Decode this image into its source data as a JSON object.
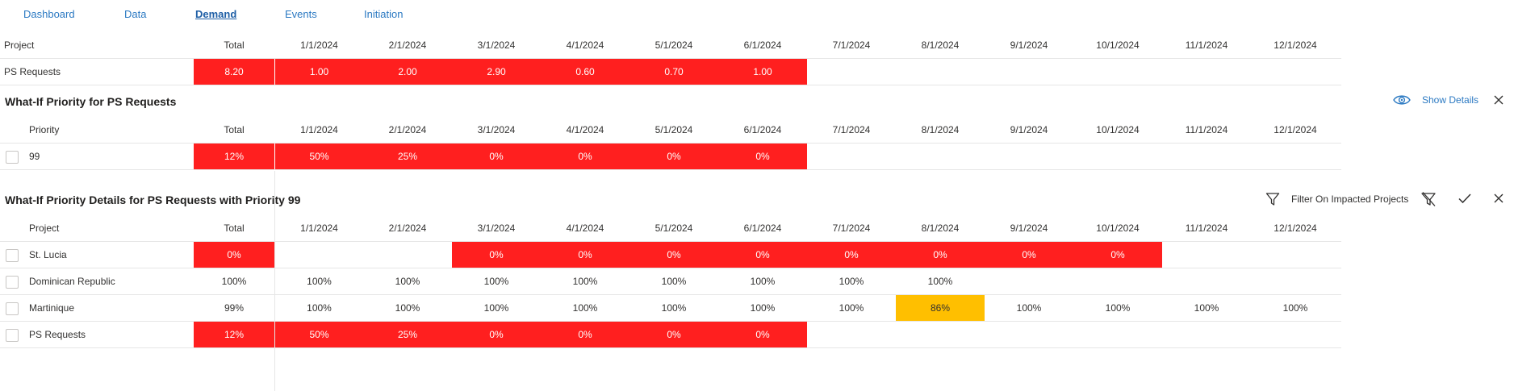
{
  "nav": {
    "tabs": [
      {
        "label": "Dashboard"
      },
      {
        "label": "Data"
      },
      {
        "label": "Demand"
      },
      {
        "label": "Events"
      },
      {
        "label": "Initiation"
      }
    ],
    "active_index": 2
  },
  "summary": {
    "columns": [
      "Project",
      "Total",
      "1/1/2024",
      "2/1/2024",
      "3/1/2024",
      "4/1/2024",
      "5/1/2024",
      "6/1/2024",
      "7/1/2024",
      "8/1/2024",
      "9/1/2024",
      "10/1/2024",
      "11/1/2024",
      "12/1/2024"
    ],
    "rows": [
      {
        "cells": [
          "PS Requests",
          "8.20",
          "1.00",
          "2.00",
          "2.90",
          "0.60",
          "0.70",
          "1.00",
          "",
          "",
          "",
          "",
          "",
          ""
        ],
        "status": [
          "none",
          "red",
          "red",
          "red",
          "red",
          "red",
          "red",
          "red",
          "none",
          "none",
          "none",
          "none",
          "none",
          "none"
        ]
      }
    ]
  },
  "priority": {
    "title": "What-If Priority for PS Requests",
    "show_details_label": "Show Details",
    "columns": [
      "Priority",
      "Total",
      "1/1/2024",
      "2/1/2024",
      "3/1/2024",
      "4/1/2024",
      "5/1/2024",
      "6/1/2024",
      "7/1/2024",
      "8/1/2024",
      "9/1/2024",
      "10/1/2024",
      "11/1/2024",
      "12/1/2024"
    ],
    "rows": [
      {
        "cells": [
          "99",
          "12%",
          "50%",
          "25%",
          "0%",
          "0%",
          "0%",
          "0%",
          "",
          "",
          "",
          "",
          "",
          ""
        ],
        "status": [
          "none",
          "red",
          "red",
          "red",
          "red",
          "red",
          "red",
          "red",
          "none",
          "none",
          "none",
          "none",
          "none",
          "none"
        ]
      }
    ]
  },
  "details": {
    "title": "What-If Priority Details for PS Requests with Priority 99",
    "filter_label": "Filter On Impacted Projects",
    "columns": [
      "Project",
      "Total",
      "1/1/2024",
      "2/1/2024",
      "3/1/2024",
      "4/1/2024",
      "5/1/2024",
      "6/1/2024",
      "7/1/2024",
      "8/1/2024",
      "9/1/2024",
      "10/1/2024",
      "11/1/2024",
      "12/1/2024"
    ],
    "rows": [
      {
        "cells": [
          "St. Lucia",
          "0%",
          "",
          "",
          "0%",
          "0%",
          "0%",
          "0%",
          "0%",
          "0%",
          "0%",
          "0%",
          "",
          ""
        ],
        "status": [
          "none",
          "red",
          "none",
          "none",
          "red",
          "red",
          "red",
          "red",
          "red",
          "red",
          "red",
          "red",
          "none",
          "none"
        ]
      },
      {
        "cells": [
          "Dominican Republic",
          "100%",
          "100%",
          "100%",
          "100%",
          "100%",
          "100%",
          "100%",
          "100%",
          "100%",
          "",
          "",
          "",
          ""
        ],
        "status": [
          "none",
          "none",
          "none",
          "none",
          "none",
          "none",
          "none",
          "none",
          "none",
          "none",
          "none",
          "none",
          "none",
          "none"
        ]
      },
      {
        "cells": [
          "Martinique",
          "99%",
          "100%",
          "100%",
          "100%",
          "100%",
          "100%",
          "100%",
          "100%",
          "86%",
          "100%",
          "100%",
          "100%",
          "100%"
        ],
        "status": [
          "none",
          "none",
          "none",
          "none",
          "none",
          "none",
          "none",
          "none",
          "none",
          "amber",
          "none",
          "none",
          "none",
          "none"
        ]
      },
      {
        "cells": [
          "PS Requests",
          "12%",
          "50%",
          "25%",
          "0%",
          "0%",
          "0%",
          "0%",
          "",
          "",
          "",
          "",
          "",
          ""
        ],
        "status": [
          "none",
          "red",
          "red",
          "red",
          "red",
          "red",
          "red",
          "red",
          "none",
          "none",
          "none",
          "none",
          "none",
          "none"
        ]
      }
    ]
  },
  "colors": {
    "red": "#ff1f1f",
    "amber": "#ffbf00",
    "link": "#2b79c2"
  },
  "icons": {
    "show_details": "eye-icon",
    "close": "close-icon",
    "filter": "filter-icon",
    "clear_filter": "clear-filter-icon",
    "apply": "checkmark-icon"
  }
}
